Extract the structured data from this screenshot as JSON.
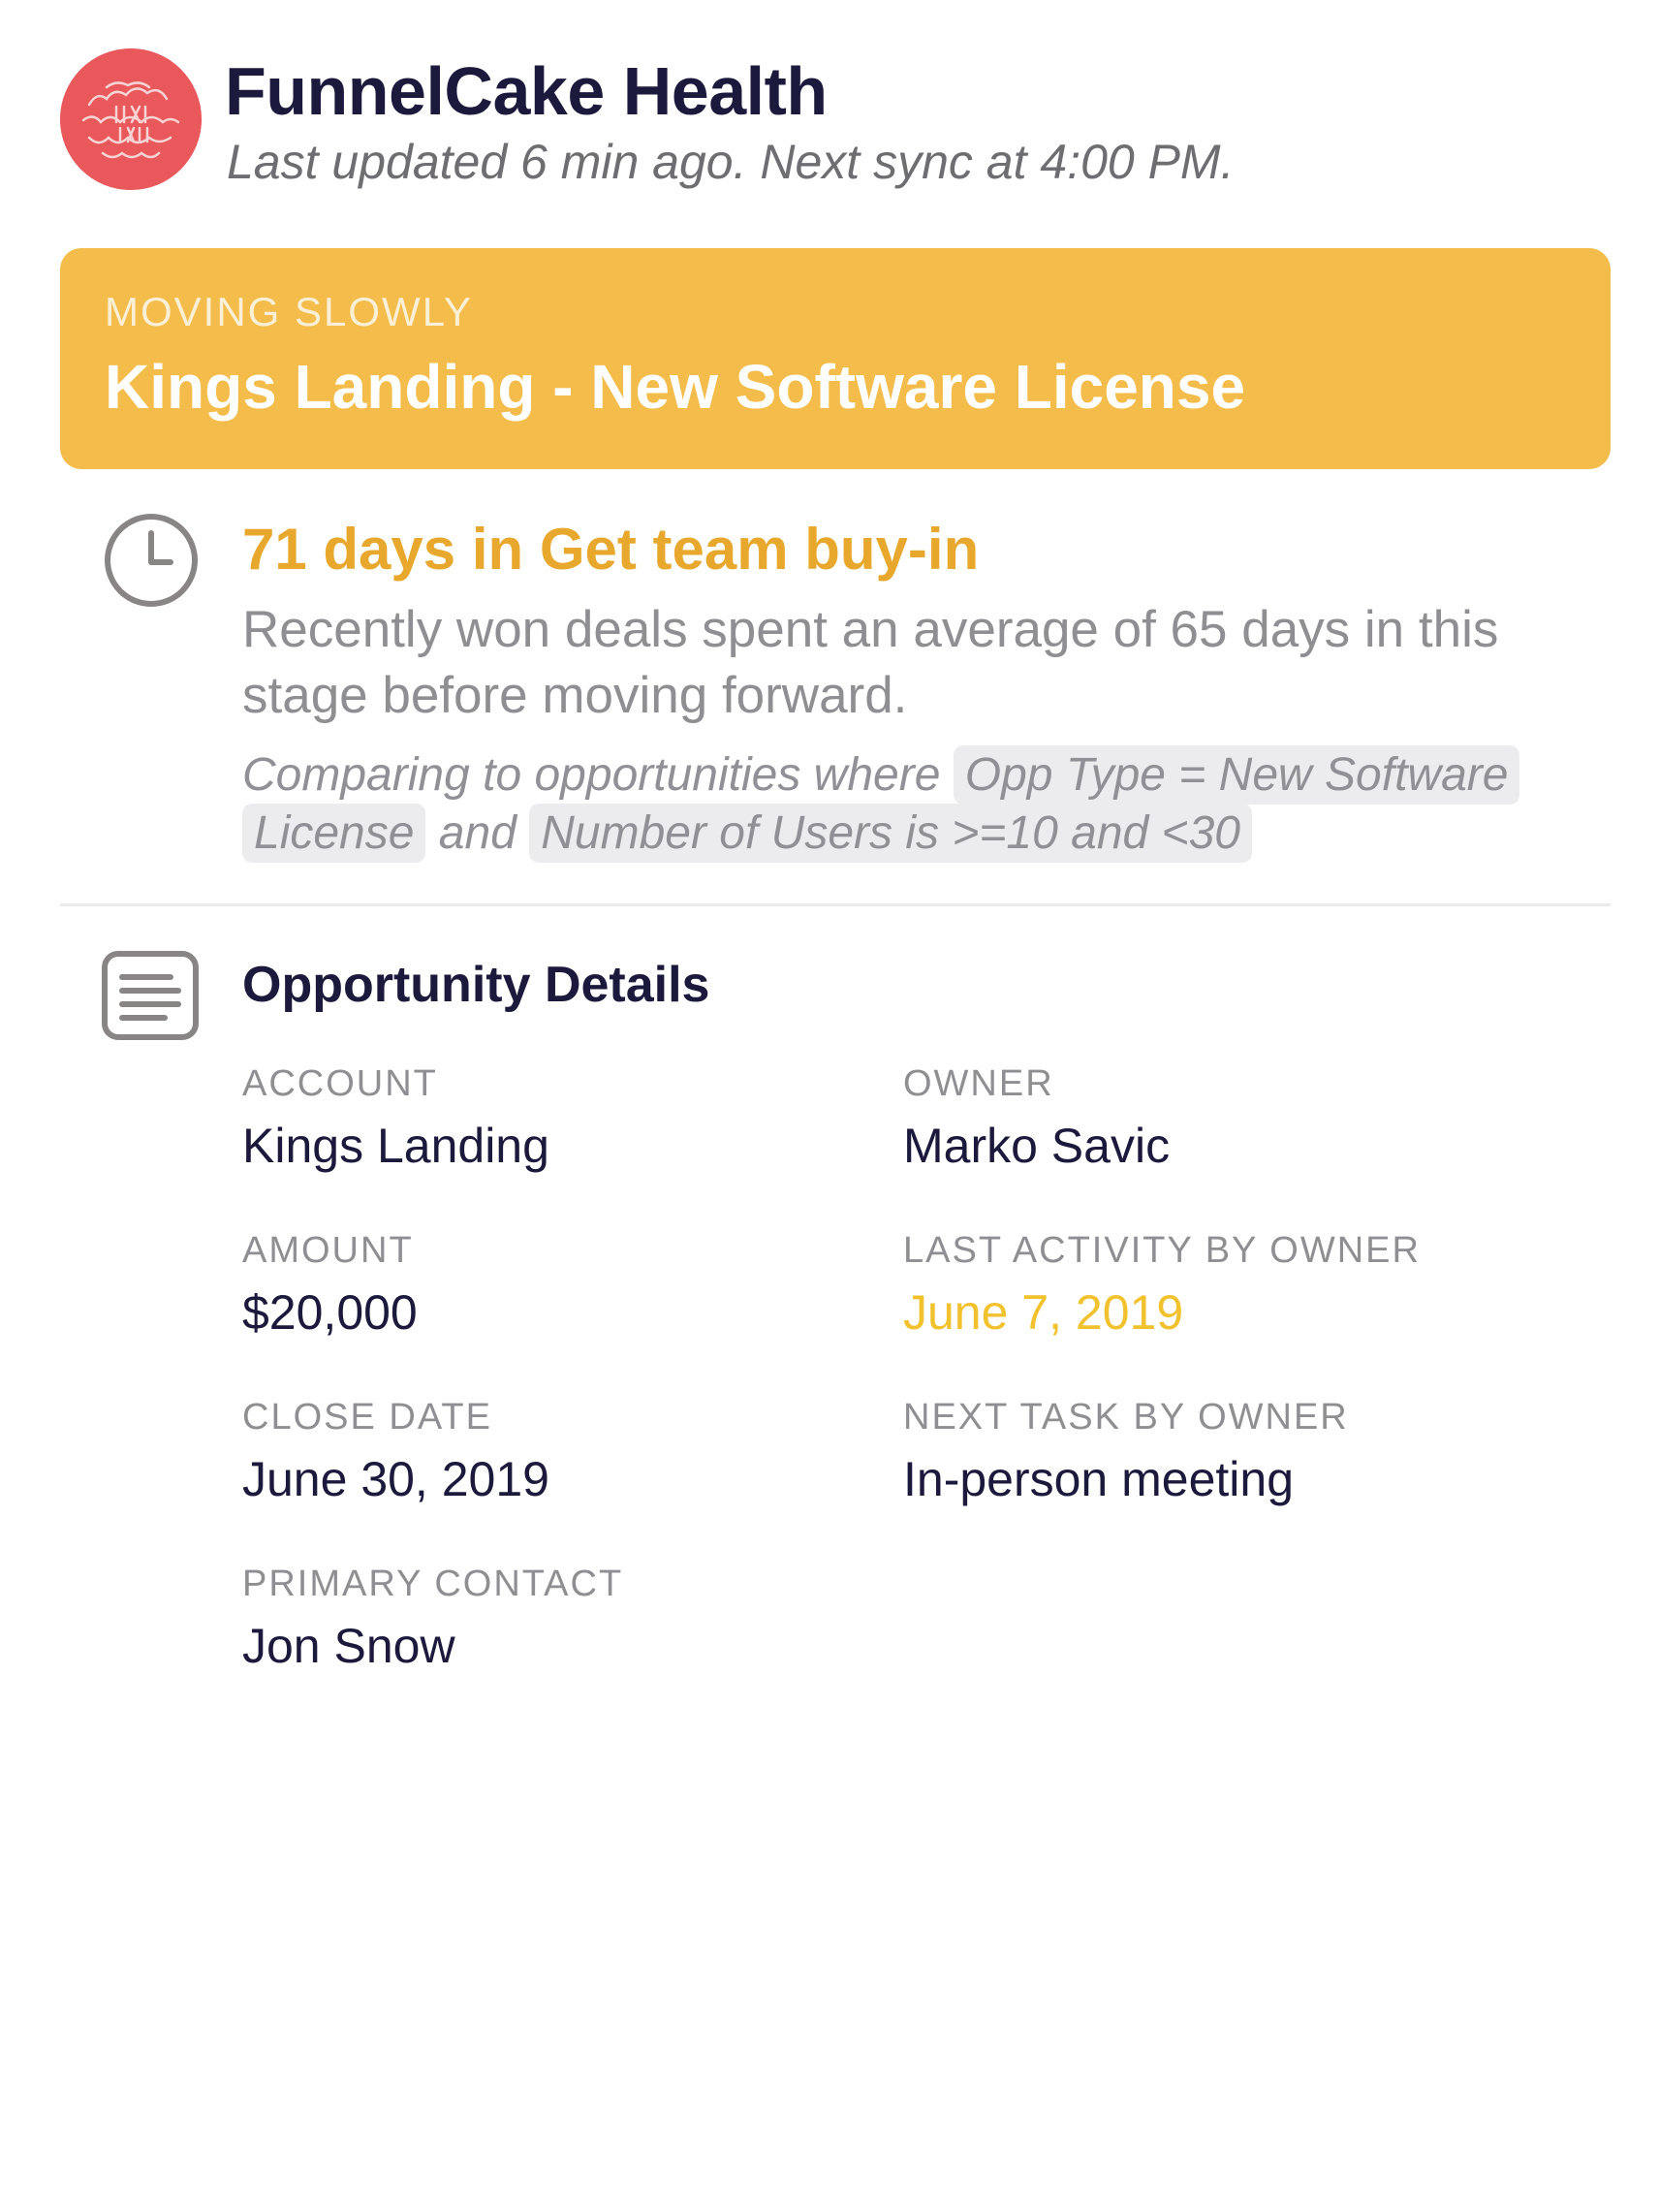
{
  "header": {
    "app_title": "FunnelCake Health",
    "sync_status": "Last updated 6 min ago. Next sync at 4:00 PM.",
    "logo_icon": "funnelcake-logo",
    "logo_color": "#e9585b"
  },
  "banner": {
    "status": "MOVING SLOWLY",
    "deal_title": "Kings Landing - New Software License",
    "color": "#f3bc4b"
  },
  "stage": {
    "icon": "clock-icon",
    "title": "71 days in Get team buy-in",
    "description": "Recently won deals spent an average of 65 days in this stage before moving forward.",
    "comparison_prefix": "Comparing to opportunities where",
    "filter_1": "Opp Type = New Software License",
    "conjunction": "and",
    "filter_2": "Number of Users is >=10 and <30"
  },
  "details": {
    "icon": "document-lines-icon",
    "title": "Opportunity Details",
    "fields": {
      "account": {
        "label": "ACCOUNT",
        "value": "Kings Landing"
      },
      "owner": {
        "label": "OWNER",
        "value": "Marko Savic"
      },
      "amount": {
        "label": "AMOUNT",
        "value": "$20,000"
      },
      "last_activity": {
        "label": "LAST ACTIVITY BY OWNER",
        "value": "June 7, 2019",
        "color": "#f2c12e"
      },
      "close_date": {
        "label": "CLOSE DATE",
        "value": "June 30, 2019"
      },
      "next_task": {
        "label": "NEXT TASK BY OWNER",
        "value": "In-person meeting"
      },
      "primary_contact": {
        "label": "PRIMARY CONTACT",
        "value": "Jon Snow"
      }
    }
  }
}
